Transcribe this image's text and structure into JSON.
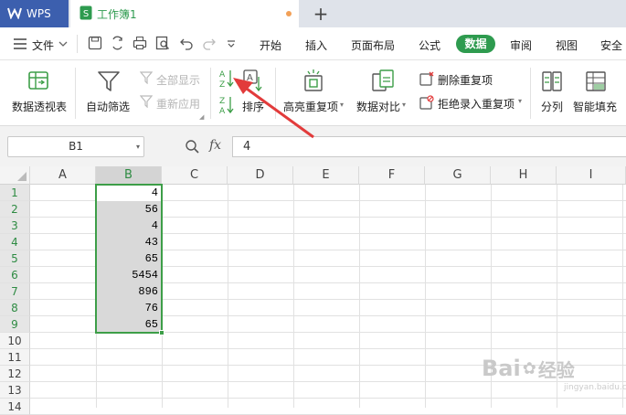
{
  "titlebar": {
    "app_name": "WPS",
    "doc_tab": "工作簿1"
  },
  "menubar": {
    "file_label": "文件",
    "tabs": [
      "开始",
      "插入",
      "页面布局",
      "公式",
      "数据",
      "审阅",
      "视图",
      "安全"
    ],
    "active_tab": "数据"
  },
  "ribbon": {
    "pivot": "数据透视表",
    "autofilter": "自动筛选",
    "show_all": "全部显示",
    "reapply": "重新应用",
    "sort": "排序",
    "highlight_dup": "高亮重复项",
    "compare": "数据对比",
    "remove_dup": "删除重复项",
    "reject_dup": "拒绝录入重复项",
    "split": "分列",
    "smart_fill": "智能填充"
  },
  "formula_bar": {
    "cell_ref": "B1",
    "fx": "fx",
    "value": "4"
  },
  "sheet": {
    "columns": [
      "A",
      "B",
      "C",
      "D",
      "E",
      "F",
      "G",
      "H",
      "I"
    ],
    "selected_column": "B",
    "rows": [
      "1",
      "2",
      "3",
      "4",
      "5",
      "6",
      "7",
      "8",
      "9",
      "10",
      "11",
      "12",
      "13",
      "14"
    ],
    "b_values": [
      "4",
      "56",
      "4",
      "43",
      "65",
      "5454",
      "896",
      "76",
      "65"
    ]
  },
  "watermark": {
    "brand": "Bai",
    "brand2": "经验",
    "sub": "jingyan.baidu.com"
  },
  "colors": {
    "accent": "#2e9b4f",
    "wps_blue": "#3c5fae",
    "arrow": "#e23b3b"
  }
}
